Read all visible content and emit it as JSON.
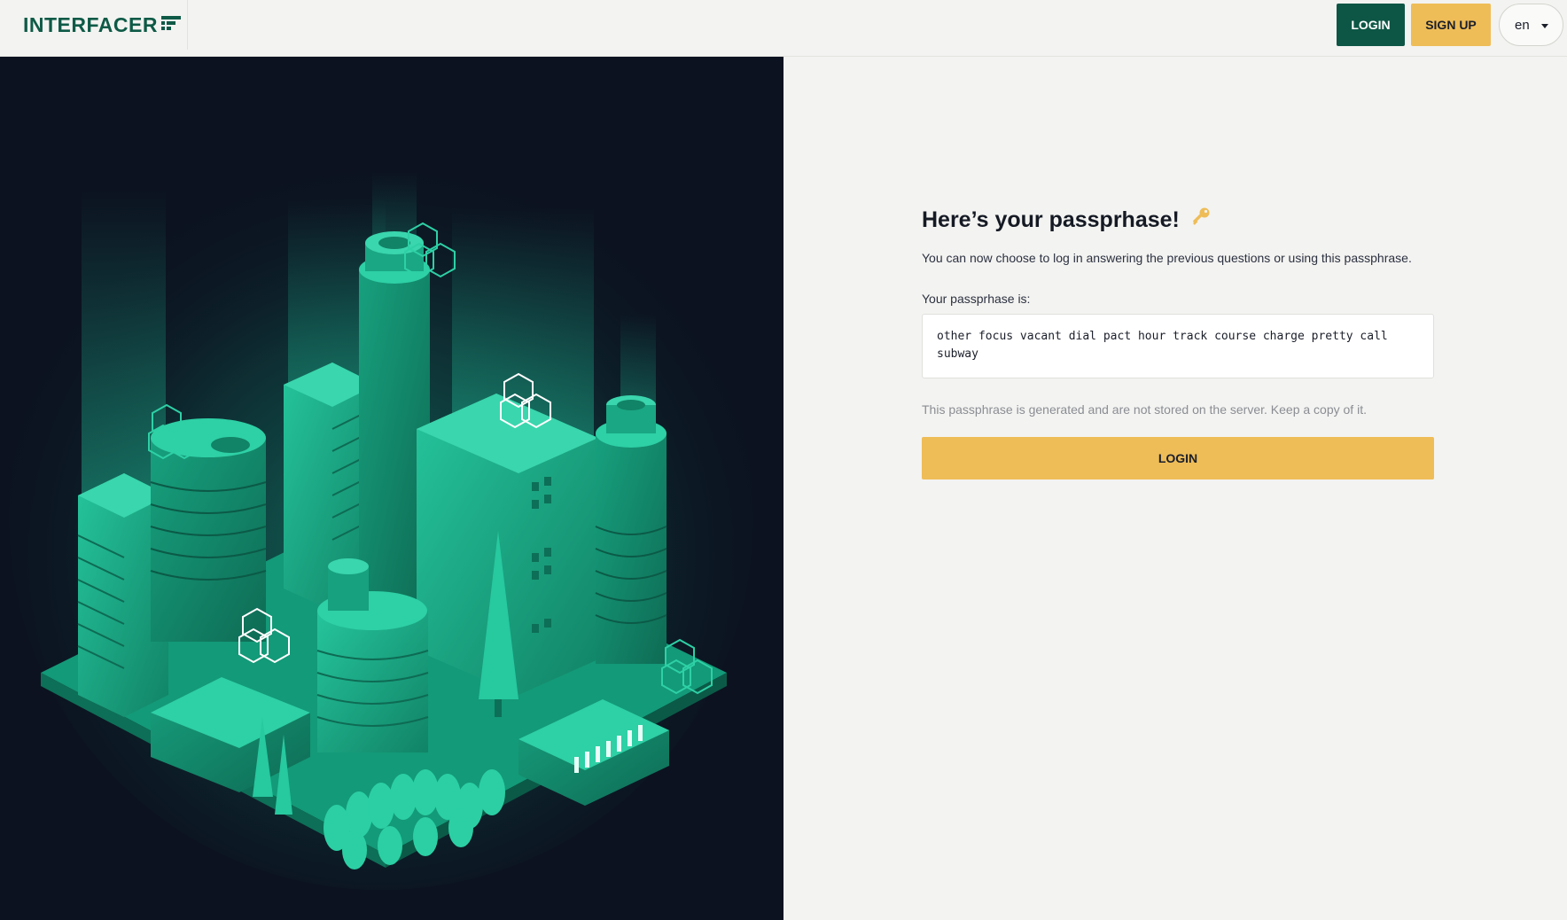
{
  "header": {
    "logo_text": "INTERFACER",
    "login_label": "LOGIN",
    "signup_label": "SIGN UP",
    "language_value": "en"
  },
  "main": {
    "title": "Here’s your passprhase!",
    "subtitle": "You can now choose to log in answering the previous questions or using this passphrase.",
    "passphrase_label": "Your passprhase is:",
    "passphrase": "other focus vacant dial pact hour track course charge pretty call subway",
    "note": "This passphrase is generated and are not stored on the server. Keep a copy of it.",
    "login_button_label": "LOGIN"
  },
  "icons": {
    "logo_mark": "stacked-bars-logo-icon",
    "title_icon": "key-icon",
    "language_caret": "chevron-down-icon"
  },
  "colors": {
    "brand_green": "#0d5645",
    "accent_yellow": "#eebd58",
    "illustration_bg": "#0c1220",
    "illustration_green": "#1db992"
  }
}
